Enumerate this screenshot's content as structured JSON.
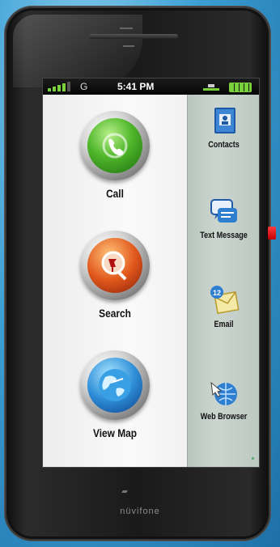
{
  "status_bar": {
    "network": "G",
    "time": "5:41 PM",
    "signal_icon": "signal-bars-icon",
    "wifi_icon": "wifi-icon",
    "battery_icon": "battery-icon"
  },
  "main_apps": [
    {
      "label": "Call",
      "icon": "phone-handset-icon"
    },
    {
      "label": "Search",
      "icon": "magnifier-pin-icon"
    },
    {
      "label": "View Map",
      "icon": "globe-map-icon"
    }
  ],
  "side_apps": [
    {
      "label": "Contacts",
      "icon": "contacts-book-icon"
    },
    {
      "label": "Text Message",
      "icon": "chat-bubbles-icon"
    },
    {
      "label": "Email",
      "icon": "email-envelope-icon",
      "badge": "12"
    },
    {
      "label": "Web Browser",
      "icon": "globe-arrow-icon"
    }
  ],
  "device": {
    "brand": "nüvifone"
  }
}
